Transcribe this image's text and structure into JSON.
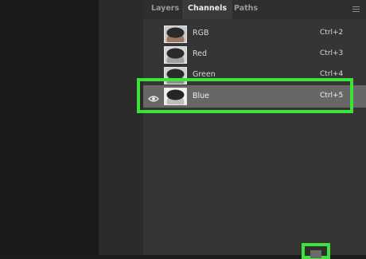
{
  "tabs": [
    {
      "label": "Layers",
      "active": false
    },
    {
      "label": "Channels",
      "active": true
    },
    {
      "label": "Paths",
      "active": false
    }
  ],
  "channels": [
    {
      "name": "RGB",
      "shortcut": "Ctrl+2",
      "visible": false,
      "selected": false
    },
    {
      "name": "Red",
      "shortcut": "Ctrl+3",
      "visible": false,
      "selected": false
    },
    {
      "name": "Green",
      "shortcut": "Ctrl+4",
      "visible": false,
      "selected": false
    },
    {
      "name": "Blue",
      "shortcut": "Ctrl+5",
      "visible": true,
      "selected": true
    }
  ],
  "icons": {
    "visibility": "eye-icon",
    "panel_menu": "menu-icon",
    "new_channel": "new-channel-icon"
  },
  "colors": {
    "highlight": "#3be33b",
    "panel_bg": "#353535",
    "selected_row": "#676767"
  }
}
